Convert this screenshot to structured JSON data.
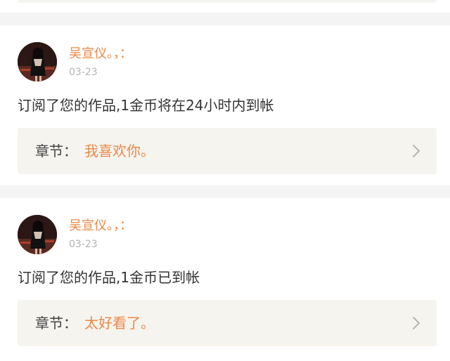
{
  "notifications": [
    {
      "username": "吴宣仪。，：",
      "date": "03-23",
      "message": "订阅了您的作品,1金币将在24小时内到帐",
      "chapter_label": "章节：",
      "chapter_title": "我喜欢你。",
      "chevron_icon": "chevron-right-icon"
    },
    {
      "username": "吴宣仪。，：",
      "date": "03-23",
      "message": "订阅了您的作品,1金币已到帐",
      "chapter_label": "章节：",
      "chapter_title": "太好看了。",
      "chevron_icon": "chevron-right-icon"
    }
  ],
  "colors": {
    "accent": "#e8894a",
    "chapter_bg": "#f6f4ee",
    "page_bg": "#f4f4f4",
    "text": "#333333",
    "muted": "#b3b3b3"
  }
}
